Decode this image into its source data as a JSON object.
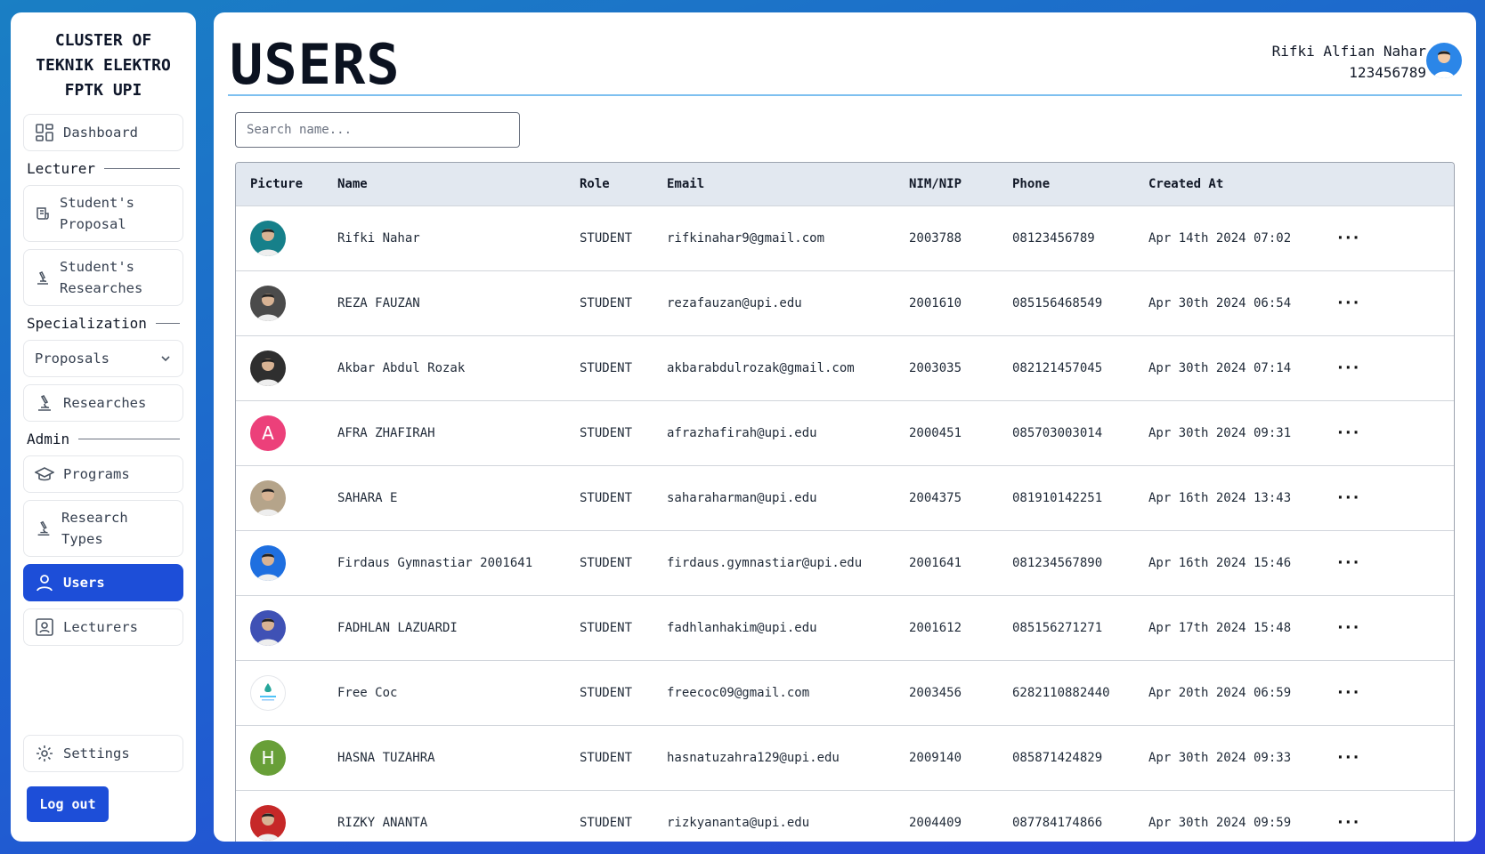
{
  "sidebar": {
    "brand": [
      "CLUSTER OF",
      "TEKNIK ELEKTRO",
      "FPTK UPI"
    ],
    "dashboard": "Dashboard",
    "section_lecturer": "Lecturer",
    "students_proposal": [
      "Student's",
      "Proposal"
    ],
    "students_researches": [
      "Student's",
      "Researches"
    ],
    "section_specialization": "Specialization",
    "proposals_dropdown": "Proposals",
    "researches": "Researches",
    "section_admin": "Admin",
    "programs": "Programs",
    "research_types": [
      "Research",
      "Types"
    ],
    "users": "Users",
    "lecturers": "Lecturers",
    "settings": "Settings",
    "logout": "Log out"
  },
  "header": {
    "title": "USERS",
    "user_name": "Rifki Alfian Nahar",
    "user_id": "123456789"
  },
  "search": {
    "placeholder": "Search name..."
  },
  "table": {
    "columns": [
      "Picture",
      "Name",
      "Role",
      "Email",
      "NIM/NIP",
      "Phone",
      "Created At"
    ],
    "rows": [
      {
        "avatar": "photo",
        "color": "#16808a",
        "initial": "",
        "name": "Rifki Nahar",
        "role": "STUDENT",
        "email": "rifkinahar9@gmail.com",
        "nim": "2003788",
        "phone": "08123456789",
        "created": "Apr 14th 2024 07:02"
      },
      {
        "avatar": "photo",
        "color": "#4b4b4b",
        "initial": "",
        "name": "REZA FAUZAN",
        "role": "STUDENT",
        "email": "rezafauzan@upi.edu",
        "nim": "2001610",
        "phone": "085156468549",
        "created": "Apr 30th 2024 06:54"
      },
      {
        "avatar": "photo",
        "color": "#2f2f2f",
        "initial": "",
        "name": "Akbar Abdul Rozak",
        "role": "STUDENT",
        "email": "akbarabdulrozak@gmail.com",
        "nim": "2003035",
        "phone": "082121457045",
        "created": "Apr 30th 2024 07:14"
      },
      {
        "avatar": "letter",
        "color": "#ec407a",
        "initial": "A",
        "name": "AFRA ZHAFIRAH",
        "role": "STUDENT",
        "email": "afrazhafirah@upi.edu",
        "nim": "2000451",
        "phone": "085703003014",
        "created": "Apr 30th 2024 09:31"
      },
      {
        "avatar": "photo",
        "color": "#b5a48a",
        "initial": "",
        "name": "SAHARA E",
        "role": "STUDENT",
        "email": "saharaharman@upi.edu",
        "nim": "2004375",
        "phone": "081910142251",
        "created": "Apr 16th 2024 13:43"
      },
      {
        "avatar": "photo",
        "color": "#1e6fe0",
        "initial": "",
        "name": "Firdaus Gymnastiar 2001641",
        "role": "STUDENT",
        "email": "firdaus.gymnastiar@upi.edu",
        "nim": "2001641",
        "phone": "081234567890",
        "created": "Apr 16th 2024 15:46"
      },
      {
        "avatar": "photo",
        "color": "#3f51b5",
        "initial": "",
        "name": "FADHLAN LAZUARDI",
        "role": "STUDENT",
        "email": "fadhlanhakim@upi.edu",
        "nim": "2001612",
        "phone": "085156271271",
        "created": "Apr 17th 2024 15:48"
      },
      {
        "avatar": "logo",
        "color": "#ffffff",
        "initial": "",
        "name": "Free Coc",
        "role": "STUDENT",
        "email": "freecoc09@gmail.com",
        "nim": "2003456",
        "phone": "6282110882440",
        "created": "Apr 20th 2024 06:59"
      },
      {
        "avatar": "letter",
        "color": "#689f38",
        "initial": "H",
        "name": "HASNA TUZAHRA",
        "role": "STUDENT",
        "email": "hasnatuzahra129@upi.edu",
        "nim": "2009140",
        "phone": "085871424829",
        "created": "Apr 30th 2024 09:33"
      },
      {
        "avatar": "photo",
        "color": "#c62828",
        "initial": "",
        "name": "RIZKY ANANTA",
        "role": "STUDENT",
        "email": "rizkyananta@upi.edu",
        "nim": "2004409",
        "phone": "087784174866",
        "created": "Apr 30th 2024 09:59"
      }
    ],
    "row_action": "···"
  }
}
